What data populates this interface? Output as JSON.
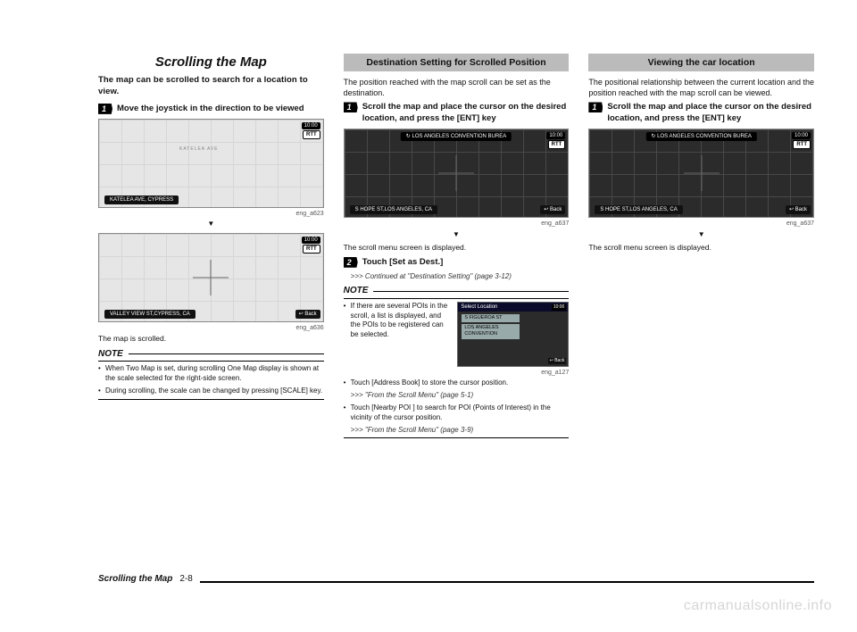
{
  "col1": {
    "title": "Scrolling the Map",
    "lead": "The map can be scrolled to search for a location to view.",
    "step1": "Move the joystick in the direction to be viewed",
    "map1": {
      "time": "10:00",
      "rtt": "RTT",
      "street": "KATELEA AVE",
      "bottom": "KATELEA AVE, CYPRESS",
      "caption": "eng_a623"
    },
    "map2": {
      "time": "10:00",
      "rtt": "RTT",
      "bottom": "VALLEY VIEW ST,CYPRESS, CA",
      "back": "↩ Back",
      "caption": "eng_a636"
    },
    "after": "The map is scrolled.",
    "note_head": "NOTE",
    "notes": [
      "When Two Map is set, during scrolling One Map display is shown at the scale selected for the right-side screen.",
      "During scrolling, the scale can be changed by pressing [SCALE] key."
    ]
  },
  "col2": {
    "subtitle": "Destination Setting for Scrolled Position",
    "lead": "The position reached with the map scroll can be set as the destination.",
    "step1": "Scroll the map and place the cursor on the desired location, and press the [ENT] key",
    "map1": {
      "top": "↻ LOS ANGELES CONVENTION BUREA",
      "time": "10:00",
      "rtt": "RTT",
      "bottom": "S HOPE ST,LOS ANGELES, CA",
      "back": "↩ Back",
      "caption": "eng_a637"
    },
    "after": "The scroll menu screen is displayed.",
    "step2": "Touch [Set as Dest.]",
    "cont": ">>> Continued at \"Destination Setting\" (page 3-12)",
    "note_head": "NOTE",
    "thumb_text": "If there are several POIs in the scroll, a list is displayed, and the POIs to be registered can be selected.",
    "thumb": {
      "sel_title": "Select Location",
      "row1": "S FIGUEROA ST",
      "row2": "LOS ANGELES CONVENTION",
      "time": "10:00",
      "back": "↩ Back",
      "caption": "eng_a127"
    },
    "notes2": [
      "Touch [Address Book] to store the cursor position.",
      "Touch [Nearby POI ] to search for POI (Points of Interest) in the vicinity of the cursor position."
    ],
    "ref1": ">>> \"From the Scroll Menu\" (page 5-1)",
    "ref2": ">>> \"From the Scroll Menu\" (page 3-9)"
  },
  "col3": {
    "subtitle": "Viewing the car location",
    "lead": "The positional relationship between the current location and the position reached with the map scroll can be viewed.",
    "step1": "Scroll the map and place the cursor on the desired location, and press the [ENT] key",
    "map1": {
      "top": "↻ LOS ANGELES CONVENTION BUREA",
      "time": "10:00",
      "rtt": "RTT",
      "bottom": "S HOPE ST,LOS ANGELES, CA",
      "back": "↩ Back",
      "caption": "eng_a637"
    },
    "after": "The scroll menu screen is displayed."
  },
  "footer": {
    "title": "Scrolling the Map",
    "page": "2-8"
  },
  "watermark": "carmanualsonline.info"
}
